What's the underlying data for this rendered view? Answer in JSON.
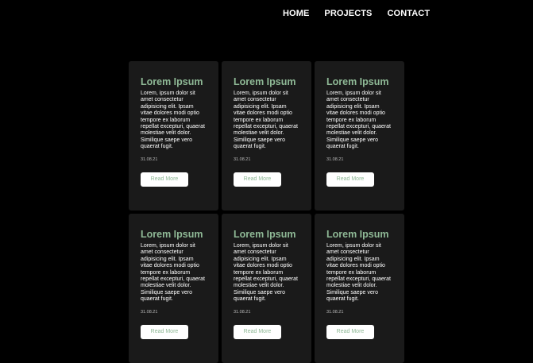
{
  "nav": {
    "home": "HOME",
    "projects": "PROJECTS",
    "contact": "CONTACT"
  },
  "cards": [
    {
      "title": "Lorem Ipsum",
      "body": "Lorem, ipsum dolor sit amet consectetur adipisicing elit. Ipsam vitae dolores modi optio tempore ex laborum repellat excepturi, quaerat molestiae velit dolor. Similique saepe vero quaerat fugit.",
      "date": "31.08.21",
      "button": "Read More"
    },
    {
      "title": "Lorem Ipsum",
      "body": "Lorem, ipsum dolor sit amet consectetur adipisicing elit. Ipsam vitae dolores modi optio tempore ex laborum repellat excepturi, quaerat molestiae velit dolor. Similique saepe vero quaerat fugit.",
      "date": "31.08.21",
      "button": "Read More"
    },
    {
      "title": "Lorem Ipsum",
      "body": "Lorem, ipsum dolor sit amet consectetur adipisicing elit. Ipsam vitae dolores modi optio tempore ex laborum repellat excepturi, quaerat molestiae velit dolor. Similique saepe vero quaerat fugit.",
      "date": "31.08.21",
      "button": "Read More"
    },
    {
      "title": "Lorem Ipsum",
      "body": "Lorem, ipsum dolor sit amet consectetur adipisicing elit. Ipsam vitae dolores modi optio tempore ex laborum repellat excepturi, quaerat molestiae velit dolor. Similique saepe vero quaerat fugit.",
      "date": "31.08.21",
      "button": "Read More"
    },
    {
      "title": "Lorem Ipsum",
      "body": "Lorem, ipsum dolor sit amet consectetur adipisicing elit. Ipsam vitae dolores modi optio tempore ex laborum repellat excepturi, quaerat molestiae velit dolor. Similique saepe vero quaerat fugit.",
      "date": "31.08.21",
      "button": "Read More"
    },
    {
      "title": "Lorem Ipsum",
      "body": "Lorem, ipsum dolor sit amet consectetur adipisicing elit. Ipsam vitae dolores modi optio tempore ex laborum repellat excepturi, quaerat molestiae velit dolor. Similique saepe vero quaerat fugit.",
      "date": "31.08.21",
      "button": "Read More"
    }
  ],
  "colors": {
    "background": "#000000",
    "card": "#1a1a1a",
    "accent": "#8fb996",
    "text": "#ffffff"
  }
}
